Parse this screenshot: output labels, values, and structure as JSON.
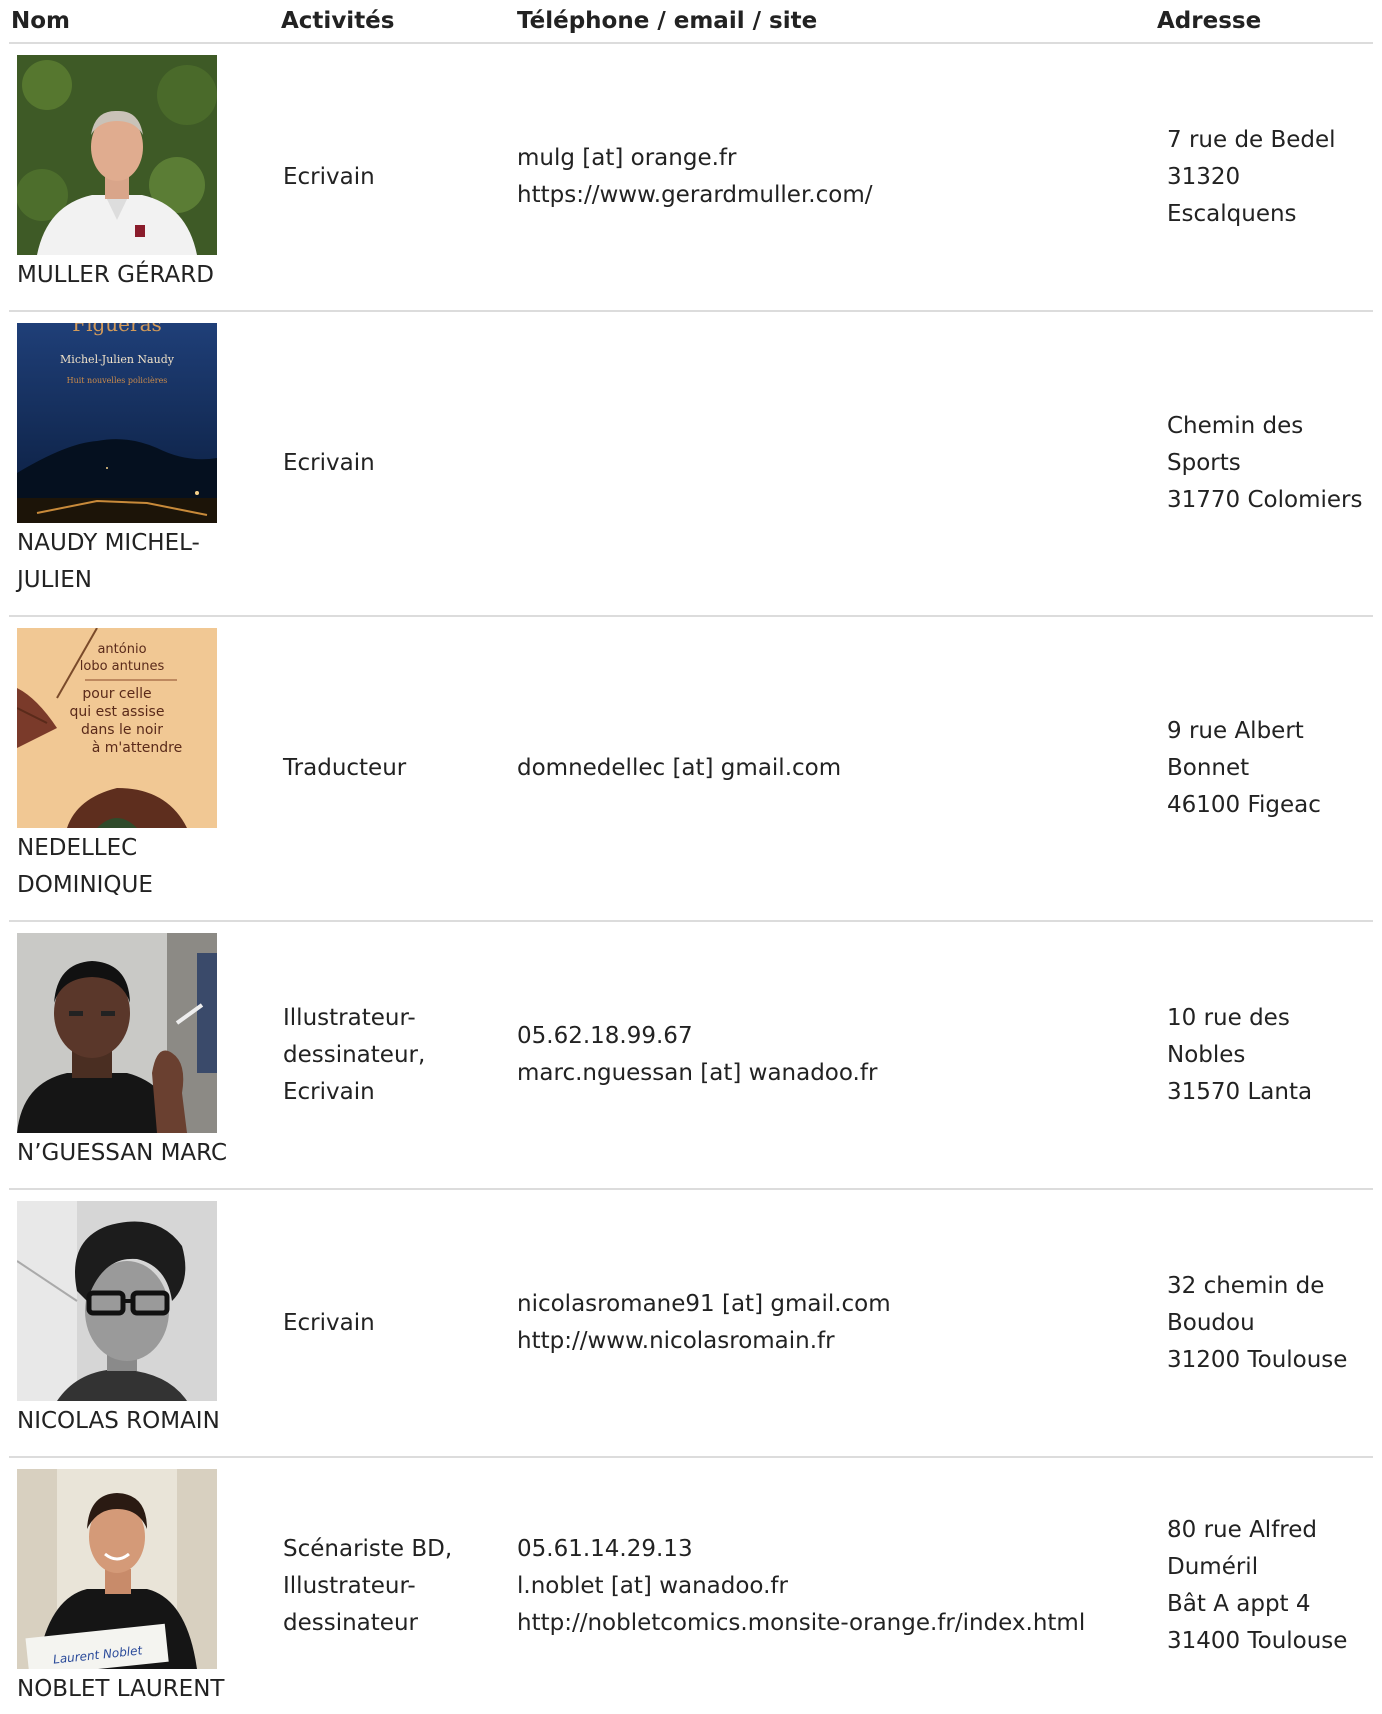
{
  "headers": {
    "nom": "Nom",
    "activites": "Activités",
    "contact": "Téléphone / email / site",
    "adresse": "Adresse"
  },
  "rows": [
    {
      "photo": "portrait-photo-muller",
      "name": "MULLER GÉRARD",
      "activities": [
        "Ecrivain"
      ],
      "contact": [
        "mulg [at] orange.fr",
        "https://www.gerardmuller.com/"
      ],
      "address": [
        "7 rue de Bedel",
        "31320",
        "Escalquens"
      ]
    },
    {
      "photo": "book-cover-naudy",
      "cover_texts": [
        "Figueras",
        "Michel-Julien Naudy",
        "Huit nouvelles policières"
      ],
      "name": "NAUDY MICHEL-JULIEN",
      "activities": [
        "Ecrivain"
      ],
      "contact": [],
      "address": [
        "Chemin des",
        "Sports",
        "31770 Colomiers"
      ]
    },
    {
      "photo": "book-cover-nedellec",
      "cover_texts": [
        "antónio",
        "lobo antunes",
        "pour celle",
        "qui est assise",
        "dans le noir",
        "à m'attendre"
      ],
      "name": "NEDELLEC DOMINIQUE",
      "activities": [
        "Traducteur"
      ],
      "contact": [
        "domnedellec [at] gmail.com"
      ],
      "address": [
        "9 rue Albert",
        "Bonnet",
        "46100 Figeac"
      ]
    },
    {
      "photo": "portrait-photo-nguessan",
      "name": "N’GUESSAN MARC",
      "activities": [
        "Illustrateur-",
        "dessinateur,",
        "Ecrivain"
      ],
      "contact": [
        "05.62.18.99.67",
        "marc.nguessan [at] wanadoo.fr"
      ],
      "address": [
        "10 rue des",
        "Nobles",
        "31570 Lanta"
      ]
    },
    {
      "photo": "portrait-photo-nicolas",
      "name": "NICOLAS ROMAIN",
      "activities": [
        "Ecrivain"
      ],
      "contact": [
        "nicolasromane91 [at] gmail.com",
        "http://www.nicolasromain.fr"
      ],
      "address": [
        "32 chemin de",
        "Boudou",
        "31200 Toulouse"
      ]
    },
    {
      "photo": "portrait-photo-noblet",
      "name_card_text": "Laurent Noblet",
      "name": "NOBLET LAURENT",
      "activities": [
        "Scénariste BD,",
        "Illustrateur-",
        "dessinateur"
      ],
      "contact": [
        "05.61.14.29.13",
        "l.noblet [at] wanadoo.fr",
        "http://nobletcomics.monsite-orange.fr/index.html"
      ],
      "address": [
        "80 rue Alfred",
        "Duméril",
        "Bât A appt 4",
        "31400 Toulouse"
      ]
    }
  ]
}
